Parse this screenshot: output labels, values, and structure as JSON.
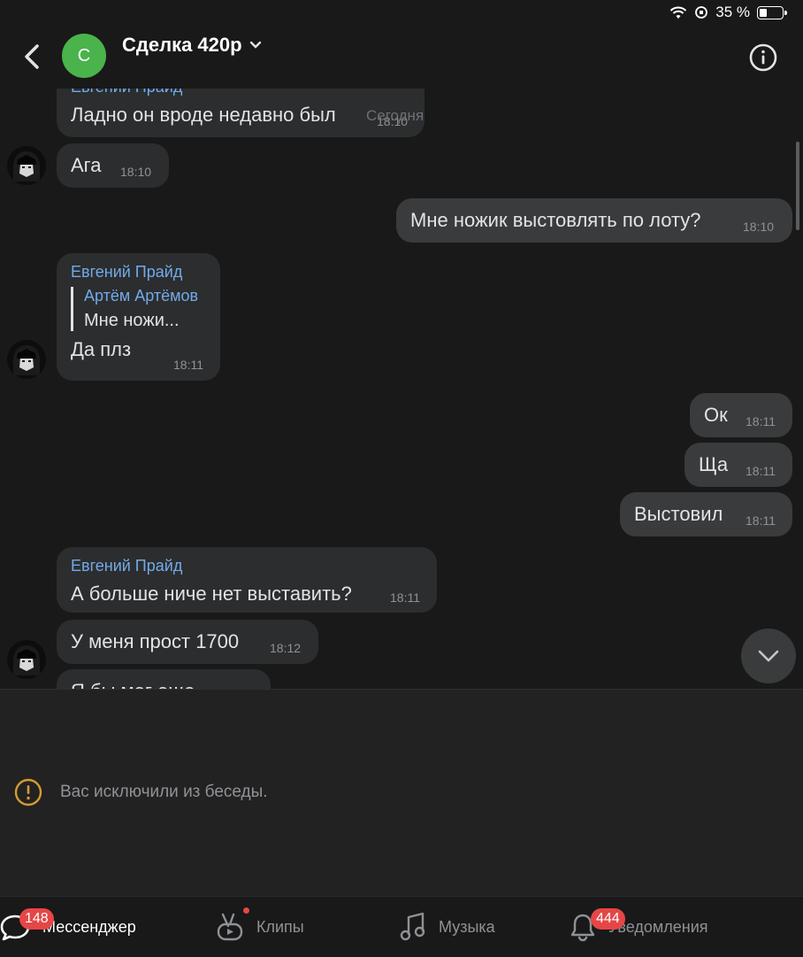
{
  "status": {
    "battery": "35 %",
    "battery_level": 0.35
  },
  "header": {
    "avatar_letter": "С",
    "title": "Сделка 420р"
  },
  "messages": {
    "date_label": "Сегодня",
    "m1": {
      "sender": "Евгений Прайд",
      "text": "Ладно он вроде недавно был",
      "time": "18:10"
    },
    "m2": {
      "text": "Ага",
      "time": "18:10"
    },
    "m3": {
      "text": "Мне ножик выстовлять по лоту?",
      "time": "18:10"
    },
    "m4": {
      "sender": "Евгений Прайд",
      "reply_name": "Артём Артёмов",
      "reply_text": "Мне ножи...",
      "text": "Да плз",
      "time": "18:11"
    },
    "m5": {
      "text": "Ок",
      "time": "18:11"
    },
    "m6": {
      "text": "Ща",
      "time": "18:11"
    },
    "m7": {
      "text": "Выстовил",
      "time": "18:11"
    },
    "m8": {
      "sender": "Евгений Прайд",
      "text": "А больше ниче нет выставить?",
      "time": "18:11"
    },
    "m9": {
      "text": "У меня прост 1700",
      "time": "18:12"
    },
    "m10": {
      "text": "Я бы мог еще"
    }
  },
  "composer": {
    "notice": "Вас исключили из беседы."
  },
  "tabs": {
    "messenger": {
      "label": "Мессенджер",
      "badge": "148"
    },
    "clips": {
      "label": "Клипы"
    },
    "music": {
      "label": "Музыка"
    },
    "notifications": {
      "label": "Уведомления",
      "badge": "444"
    }
  },
  "colors": {
    "accent": "#71aaeb",
    "badge": "#e64646",
    "avatar": "#4bb34b",
    "warning": "#d59b30"
  }
}
